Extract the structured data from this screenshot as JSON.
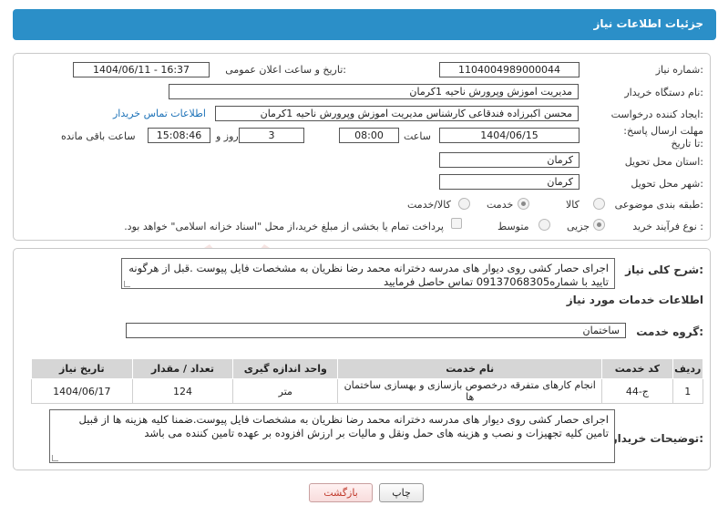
{
  "header": {
    "title": "جزئیات اطلاعات نیاز"
  },
  "form": {
    "need_number_label": "شماره نیاز:",
    "need_number": "1104004989000044",
    "announce_label": "تاریخ و ساعت اعلان عمومی:",
    "announce_value": "1404/06/11 - 16:37",
    "buyer_org_label": "نام دستگاه خریدار:",
    "buyer_org": "مدیریت اموزش وپرورش ناحیه 1کرمان",
    "creator_label": "ایجاد کننده درخواست:",
    "creator": "محسن اکبرزاده فندقاعی کارشناس  مدیریت اموزش وپرورش ناحیه 1کرمان",
    "contact_link": "اطلاعات تماس خریدار",
    "deadline_label": "مهلت ارسال پاسخ: تا تاریخ:",
    "deadline_date": "1404/06/15",
    "time_label": "ساعت",
    "deadline_time": "08:00",
    "days_count": "3",
    "days_label": "روز و",
    "remaining_time": "15:08:46",
    "remaining_label": "ساعت باقی مانده",
    "province_label": "استان محل تحویل:",
    "province": "کرمان",
    "city_label": "شهر محل تحویل:",
    "city": "کرمان",
    "category_label": "طبقه بندی موضوعی:",
    "category_options": [
      "کالا",
      "خدمت",
      "کالا/خدمت"
    ],
    "category_selected": "خدمت",
    "process_label": "نوع فرآیند خرید :",
    "process_options": [
      "جزیی",
      "متوسط"
    ],
    "process_selected": "جزیی",
    "payment_note": "پرداخت تمام یا بخشی از مبلغ خرید،از محل \"اسناد خزانه اسلامی\" خواهد بود."
  },
  "details": {
    "summary_label": "شرح کلی نیاز:",
    "summary": "اجرای حصار کشی روی دیوار های مدرسه دخترانه محمد رضا نظریان به مشخصات فایل پیوست .قبل از هرگونه تایید با شماره09137068305 تماس حاصل فرمایید",
    "services_title": "اطلاعات خدمات مورد نیاز",
    "service_group_label": "گروه خدمت:",
    "service_group": "ساختمان",
    "table": {
      "headers": [
        "ردیف",
        "کد خدمت",
        "نام خدمت",
        "واحد اندازه گیری",
        "تعداد / مقدار",
        "تاریخ نیاز"
      ],
      "rows": [
        [
          "1",
          "ج-44",
          "انجام کارهای متفرقه درخصوص بازسازی و بهسازی ساختمان ها",
          "متر",
          "124",
          "1404/06/17"
        ]
      ]
    },
    "buyer_notes_label": "توضیحات خریدار:",
    "buyer_notes": "اجرای حصار کشی روی دیوار های مدرسه دخترانه محمد رضا نظریان به مشخصات فایل پیوست.ضمنا کلیه هزینه ها از قبیل تامین کلیه تجهیزات و نصب و هزینه های حمل ونقل و مالیات بر ارزش افزوده بر عهده تامین کننده می باشد"
  },
  "buttons": {
    "print": "چاپ",
    "back": "بازگشت"
  },
  "colors": {
    "header_bg": "#2b8fc8",
    "link": "#1d72b8",
    "back_text": "#c0392b",
    "watermark": "#c0392b"
  }
}
